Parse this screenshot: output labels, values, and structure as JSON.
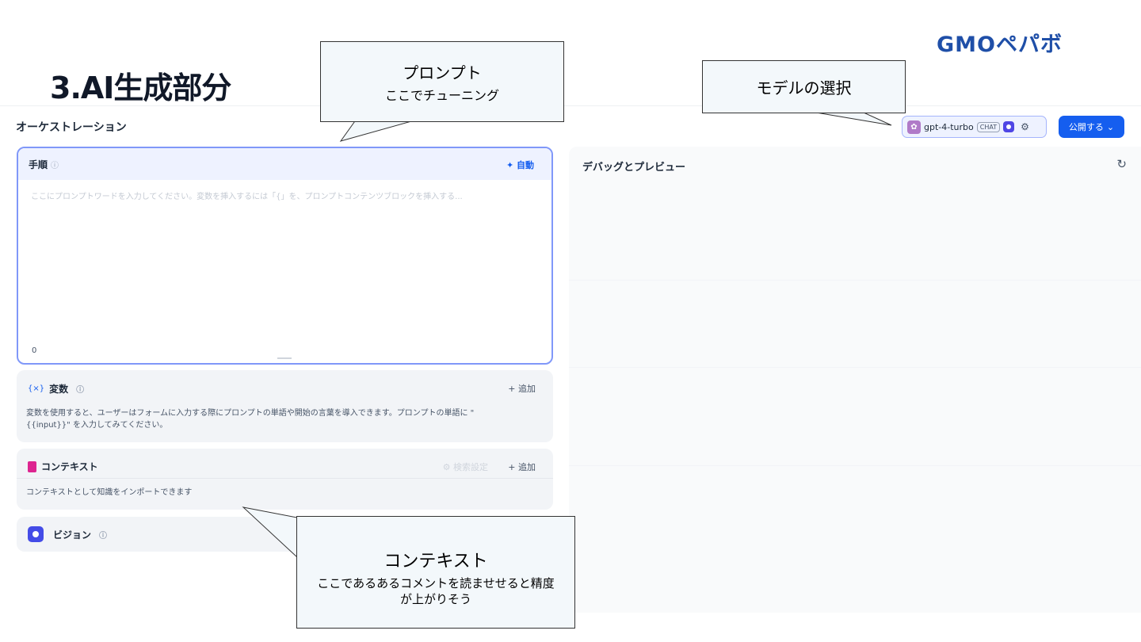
{
  "slide": {
    "title": "3.AI生成部分",
    "logo": "GMOペパボ"
  },
  "app": {
    "section_title": "オーケストレーション",
    "model": {
      "name": "gpt-4-turbo",
      "mode_tag": "CHAT",
      "icon": "openai-icon"
    },
    "publish_label": "公開する",
    "instructions": {
      "label": "手順",
      "auto_label": "自動",
      "placeholder": "ここにプロンプトワードを入力してください。変数を挿入するには「{」を、プロンプトコンテンツブロックを挿入する...",
      "char_count": "0"
    },
    "variables": {
      "icon_text": "{×}",
      "label": "変数",
      "add_label": "追加",
      "description_line1": "変数を使用すると、ユーザーはフォームに入力する際にプロンプトの単語や開始の言葉を導入できます。プロンプトの単語に \"",
      "description_line2": "{{input}}\" を入力してみてください。"
    },
    "context": {
      "label": "コンテキスト",
      "search_settings": "検索設定",
      "add_label": "追加",
      "description": "コンテキストとして知識をインポートできます"
    },
    "vision": {
      "label": "ビジョン"
    },
    "debug": {
      "title": "デバッグとプレビュー"
    }
  },
  "callouts": {
    "prompt": {
      "title": "プロンプト",
      "subtitle": "ここでチューニング"
    },
    "model": {
      "title": "モデルの選択"
    },
    "context": {
      "title": "コンテキスト",
      "line1": "ここであるあるコメントを読ませせると精度",
      "line2": "が上がりそう"
    }
  },
  "colors": {
    "accent": "#155eef",
    "instruction_border": "#8098f9",
    "logo": "#1f4fa8"
  }
}
